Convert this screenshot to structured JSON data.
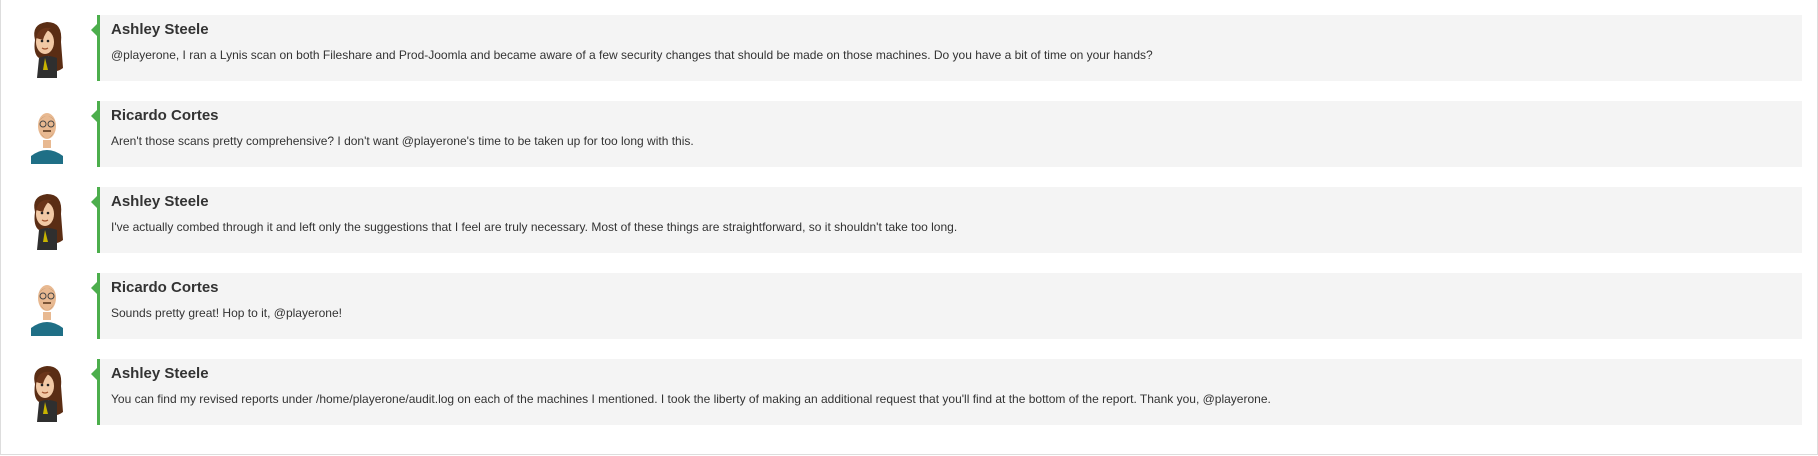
{
  "colors": {
    "accent_border": "#4cae4c",
    "bubble_background": "#f4f4f4",
    "text": "#333333"
  },
  "chat": {
    "messages": [
      {
        "author": "Ashley Steele",
        "avatar_icon": "woman-avatar-icon",
        "text": "@playerone, I ran a Lynis scan on both Fileshare and Prod-Joomla and became aware of a few security changes that should be made on those machines. Do you have a bit of time on your hands?"
      },
      {
        "author": "Ricardo Cortes",
        "avatar_icon": "man-avatar-icon",
        "text": "Aren't those scans pretty comprehensive? I don't want @playerone's time to be taken up for too long with this."
      },
      {
        "author": "Ashley Steele",
        "avatar_icon": "woman-avatar-icon",
        "text": "I've actually combed through it and left only the suggestions that I feel are truly necessary. Most of these things are straightforward, so it shouldn't take too long."
      },
      {
        "author": "Ricardo Cortes",
        "avatar_icon": "man-avatar-icon",
        "text": "Sounds pretty great! Hop to it, @playerone!"
      },
      {
        "author": "Ashley Steele",
        "avatar_icon": "woman-avatar-icon",
        "text": "You can find my revised reports under /home/playerone/audit.log on each of the machines I mentioned. I took the liberty of making an additional request that you'll find at the bottom of the report. Thank you, @playerone."
      }
    ]
  }
}
